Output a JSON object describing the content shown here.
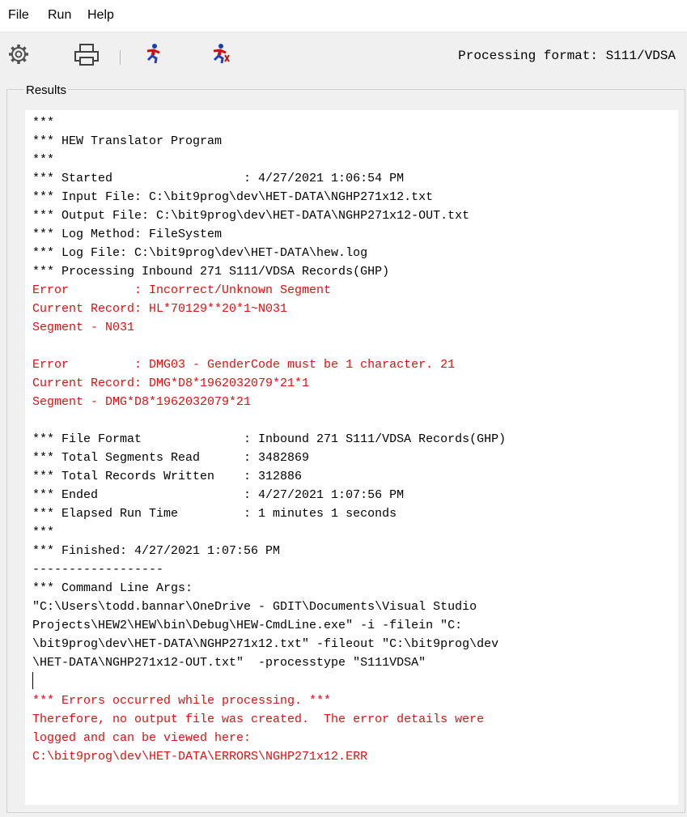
{
  "menu": {
    "file": "File",
    "run": "Run",
    "help": "Help"
  },
  "toolbar": {
    "icons": [
      "gear-icon",
      "printer-icon",
      "runner-icon",
      "runner-stop-icon"
    ],
    "status": "Processing format: S111/VDSA"
  },
  "results": {
    "label": "Results",
    "lines": [
      {
        "text": "***",
        "error": false
      },
      {
        "text": "*** HEW Translator Program",
        "error": false
      },
      {
        "text": "***",
        "error": false
      },
      {
        "text": "*** Started                  : 4/27/2021 1:06:54 PM",
        "error": false
      },
      {
        "text": "*** Input File: C:\\bit9prog\\dev\\HET-DATA\\NGHP271x12.txt",
        "error": false
      },
      {
        "text": "*** Output File: C:\\bit9prog\\dev\\HET-DATA\\NGHP271x12-OUT.txt",
        "error": false
      },
      {
        "text": "*** Log Method: FileSystem",
        "error": false
      },
      {
        "text": "*** Log File: C:\\bit9prog\\dev\\HET-DATA\\hew.log",
        "error": false
      },
      {
        "text": "*** Processing Inbound 271 S111/VDSA Records(GHP)",
        "error": false
      },
      {
        "text": "Error         : Incorrect/Unknown Segment",
        "error": true
      },
      {
        "text": "Current Record: HL*70129**20*1~N031",
        "error": true
      },
      {
        "text": "Segment - N031",
        "error": true
      },
      {
        "text": "",
        "error": false
      },
      {
        "text": "Error         : DMG03 - GenderCode must be 1 character. 21",
        "error": true
      },
      {
        "text": "Current Record: DMG*D8*1962032079*21*1",
        "error": true
      },
      {
        "text": "Segment - DMG*D8*1962032079*21",
        "error": true
      },
      {
        "text": "",
        "error": false
      },
      {
        "text": "*** File Format              : Inbound 271 S111/VDSA Records(GHP)",
        "error": false
      },
      {
        "text": "*** Total Segments Read      : 3482869",
        "error": false
      },
      {
        "text": "*** Total Records Written    : 312886",
        "error": false
      },
      {
        "text": "*** Ended                    : 4/27/2021 1:07:56 PM",
        "error": false
      },
      {
        "text": "*** Elapsed Run Time         : 1 minutes 1 seconds",
        "error": false
      },
      {
        "text": "***",
        "error": false
      },
      {
        "text": "*** Finished: 4/27/2021 1:07:56 PM",
        "error": false
      },
      {
        "text": "------------------",
        "error": false
      },
      {
        "text": "*** Command Line Args:",
        "error": false
      },
      {
        "text": "\"C:\\Users\\todd.bannar\\OneDrive - GDIT\\Documents\\Visual Studio",
        "error": false
      },
      {
        "text": "Projects\\HEW2\\HEW\\bin\\Debug\\HEW-CmdLine.exe\" -i -filein \"C:",
        "error": false
      },
      {
        "text": "\\bit9prog\\dev\\HET-DATA\\NGHP271x12.txt\" -fileout \"C:\\bit9prog\\dev",
        "error": false
      },
      {
        "text": "\\HET-DATA\\NGHP271x12-OUT.txt\"  -processtype \"S111VDSA\"",
        "error": false
      },
      {
        "text": "",
        "error": false,
        "caret": true
      },
      {
        "text": "*** Errors occurred while processing. ***",
        "error": true
      },
      {
        "text": "Therefore, no output file was created.  The error details were",
        "error": true
      },
      {
        "text": "logged and can be viewed here:",
        "error": true
      },
      {
        "text": "C:\\bit9prog\\dev\\HET-DATA\\ERRORS\\NGHP271x12.ERR",
        "error": true
      }
    ]
  },
  "colors": {
    "error": "#e01010",
    "text": "#000000",
    "background": "#f0f0f0",
    "results_bg": "#ffffff"
  }
}
